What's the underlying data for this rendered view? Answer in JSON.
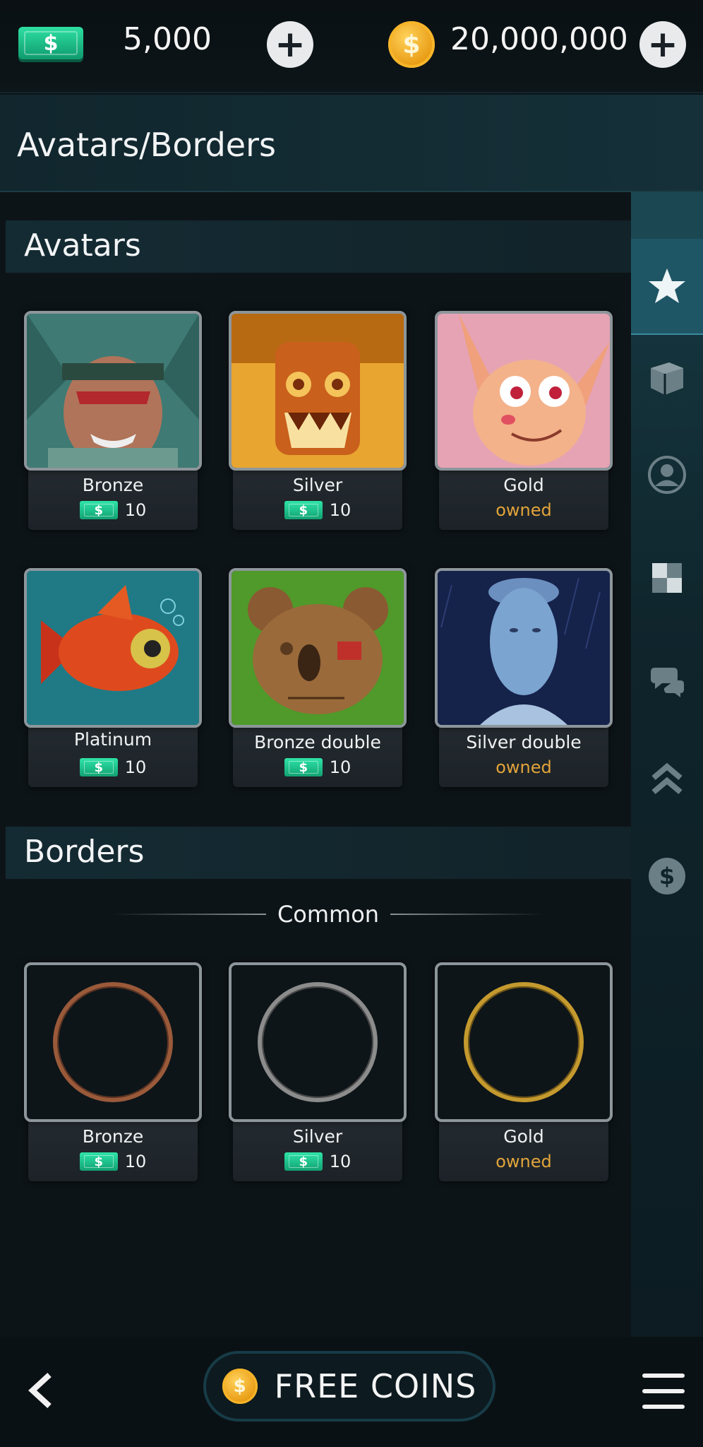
{
  "topbar": {
    "cash_amount": "5,000",
    "coin_amount": "20,000,000",
    "cash_symbol": "$",
    "coin_symbol": "$"
  },
  "page": {
    "title": "Avatars/Borders"
  },
  "avatars_section": {
    "title": "Avatars",
    "items": [
      {
        "name": "Bronze",
        "price": "10",
        "status": "price"
      },
      {
        "name": "Silver",
        "price": "10",
        "status": "price"
      },
      {
        "name": "Gold",
        "status": "owned",
        "status_label": "owned"
      },
      {
        "name": "Platinum",
        "price": "10",
        "status": "price"
      },
      {
        "name": "Bronze double",
        "price": "10",
        "status": "price"
      },
      {
        "name": "Silver double",
        "status": "owned",
        "status_label": "owned"
      }
    ]
  },
  "borders_section": {
    "title": "Borders",
    "group_label": "Common",
    "items": [
      {
        "name": "Bronze",
        "price": "10",
        "status": "price",
        "ring_color": "#9a5a3a"
      },
      {
        "name": "Silver",
        "price": "10",
        "status": "price",
        "ring_color": "#8c8c8c"
      },
      {
        "name": "Gold",
        "status": "owned",
        "status_label": "owned",
        "ring_color": "#c49a2e"
      }
    ]
  },
  "sidebar": {
    "items": [
      {
        "icon": "star-icon",
        "active": true
      },
      {
        "icon": "cube-icon",
        "active": false
      },
      {
        "icon": "user-icon",
        "active": false
      },
      {
        "icon": "checker-icon",
        "active": false
      },
      {
        "icon": "chat-icon",
        "active": false
      },
      {
        "icon": "rank-chevrons-icon",
        "active": false
      },
      {
        "icon": "dollar-icon",
        "active": false
      }
    ]
  },
  "bottombar": {
    "free_coins_label": "FREE COINS",
    "coin_symbol": "$"
  },
  "colors": {
    "owned": "#e2a43a",
    "cash_green": "#1fc28a",
    "coin_gold": "#f0a524"
  }
}
